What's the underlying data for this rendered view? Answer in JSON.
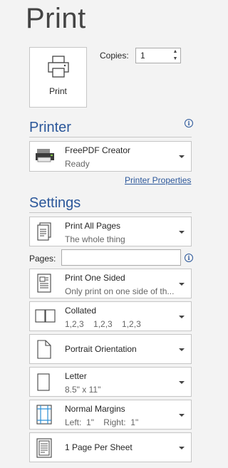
{
  "header": {
    "title": "Print"
  },
  "print_button": {
    "label": "Print",
    "icon": "printer-icon"
  },
  "copies": {
    "label": "Copies:",
    "value": "1",
    "up": "▲",
    "down": "▼"
  },
  "printer": {
    "heading": "Printer",
    "info_icon": "i",
    "selected": {
      "name": "FreePDF Creator",
      "status": "Ready",
      "icon": "printer-device-icon"
    },
    "properties_link": "Printer Properties"
  },
  "settings": {
    "heading": "Settings",
    "pages_label": "Pages:",
    "pages_value": "",
    "info_icon": "i",
    "items": [
      {
        "primary": "Print All Pages",
        "secondary": "The whole thing",
        "icon": "pages-icon"
      },
      {
        "primary": "Print One Sided",
        "secondary": "Only print on one side of th...",
        "icon": "one-sided-icon"
      },
      {
        "primary": "Collated",
        "secondary": "1,2,3    1,2,3    1,2,3",
        "icon": "collated-icon"
      },
      {
        "primary": "Portrait Orientation",
        "secondary": "",
        "icon": "portrait-icon"
      },
      {
        "primary": "Letter",
        "secondary": "8.5\" x 11\"",
        "icon": "letter-icon"
      },
      {
        "primary": "Normal Margins",
        "secondary": "Left:  1\"    Right:  1\"",
        "icon": "margins-icon"
      },
      {
        "primary": "1 Page Per Sheet",
        "secondary": "",
        "icon": "page-per-sheet-icon"
      }
    ]
  },
  "colors": {
    "accent": "#2b579a",
    "background": "#f3f3f3",
    "border": "#c6c6c6"
  }
}
